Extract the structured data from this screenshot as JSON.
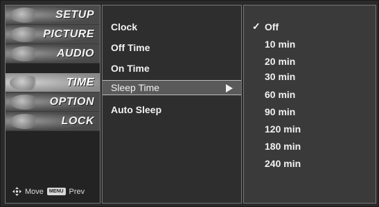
{
  "categories": [
    {
      "label": "SETUP"
    },
    {
      "label": "PICTURE"
    },
    {
      "label": "AUDIO"
    },
    {
      "label": "TIME"
    },
    {
      "label": "OPTION"
    },
    {
      "label": "LOCK"
    }
  ],
  "selected_category": "TIME",
  "legend": {
    "move_label": "Move",
    "menu_key": "MENU",
    "prev_label": "Prev"
  },
  "items": [
    {
      "label": "Clock"
    },
    {
      "label": "Off Time"
    },
    {
      "label": "On Time"
    },
    {
      "label": "Sleep Time"
    },
    {
      "label": "Auto Sleep"
    }
  ],
  "selected_item": "Sleep Time",
  "options": [
    {
      "label": "Off"
    },
    {
      "label": "10 min"
    },
    {
      "label": "20 min"
    },
    {
      "label": "30 min"
    },
    {
      "label": "60 min"
    },
    {
      "label": "90 min"
    },
    {
      "label": "120 min"
    },
    {
      "label": "180 min"
    },
    {
      "label": "240 min"
    }
  ],
  "checked_option": "Off",
  "colors": {
    "background": "#2a2a2a",
    "selected_row": "#5a5a5a",
    "text": "#f2f2f2"
  }
}
